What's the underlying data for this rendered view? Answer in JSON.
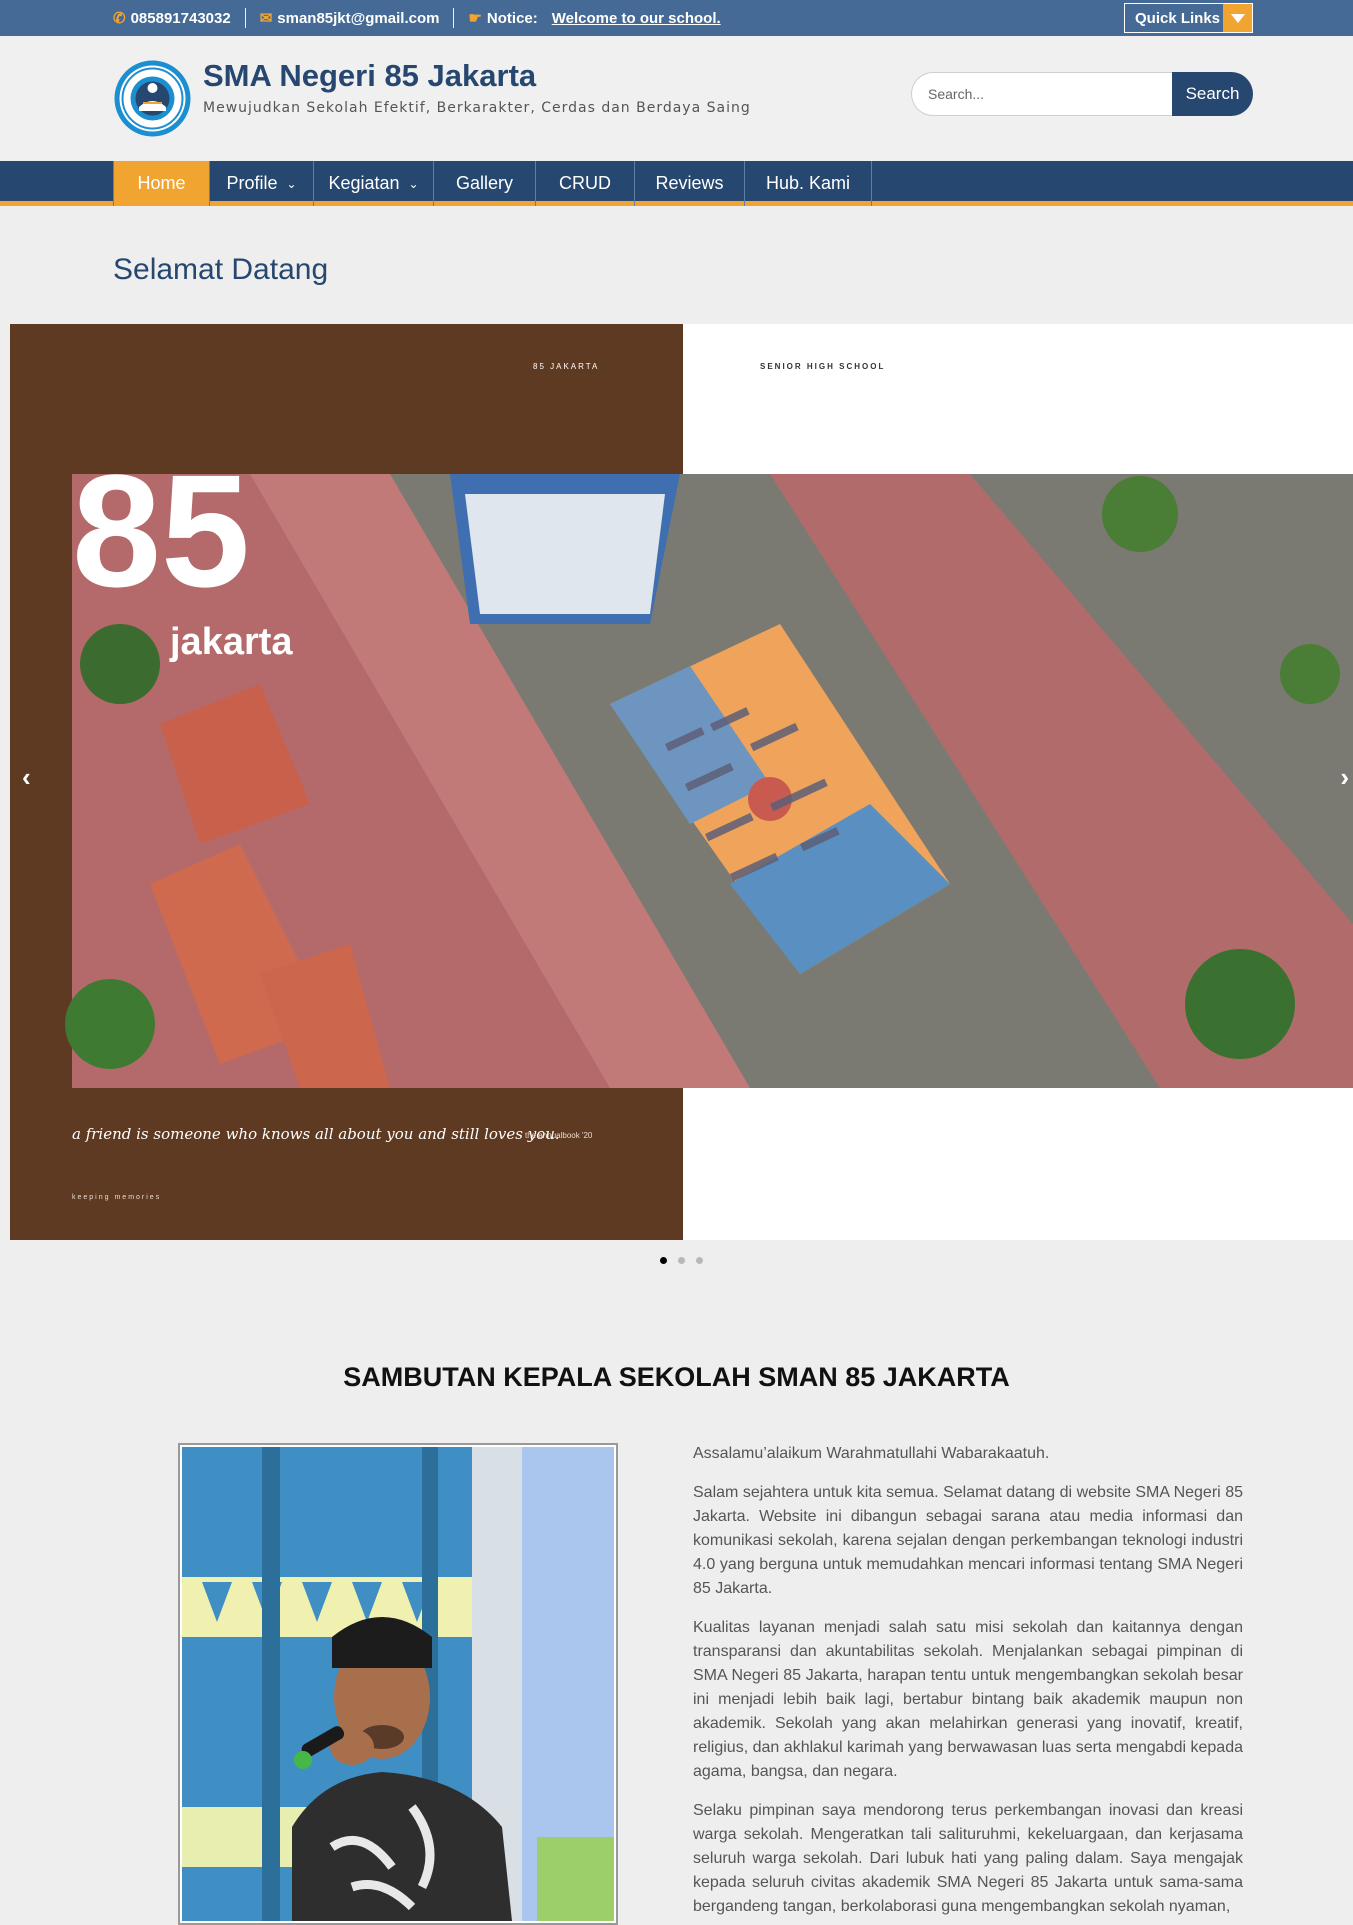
{
  "topbar": {
    "phone": "085891743032",
    "email": "sman85jkt@gmail.com",
    "notice_label": "Notice:",
    "notice_text": "Welcome to our school.",
    "quick_links": "Quick Links"
  },
  "header": {
    "site_title": "SMA Negeri 85 Jakarta",
    "site_description": "Mewujudkan Sekolah Efektif, Berkarakter, Cerdas dan Berdaya Saing",
    "search_placeholder": "Search...",
    "search_button": "Search"
  },
  "nav": {
    "items": [
      {
        "label": "Home"
      },
      {
        "label": "Profile"
      },
      {
        "label": "Kegiatan"
      },
      {
        "label": "Gallery"
      },
      {
        "label": "CRUD"
      },
      {
        "label": "Reviews"
      },
      {
        "label": "Hub. Kami"
      }
    ]
  },
  "welcome": {
    "title": "Selamat Datang"
  },
  "slider": {
    "prev": "‹",
    "next": "›",
    "slide_texts": {
      "school_tag": "85 JAKARTA",
      "level_tag": "SENIOR HIGH SCHOOL",
      "big_number": "85",
      "city": "jakarta",
      "quote": "a friend is someone who knows all about you and still loves you.",
      "annual": "the annualbook '20",
      "footer": "keeping memories"
    },
    "active_slide": 1,
    "slide_count": 3
  },
  "sambutan": {
    "title": "SAMBUTAN KEPALA SEKOLAH SMAN 85 JAKARTA",
    "paragraphs": [
      "Assalamu’alaikum Warahmatullahi Wabarakaatuh.",
      "Salam sejahtera untuk kita semua. Selamat datang di website SMA Negeri 85 Jakarta. Website ini dibangun sebagai sarana atau media informasi dan komunikasi sekolah, karena sejalan dengan perkembangan teknologi industri 4.0 yang berguna untuk memudahkan mencari informasi tentang SMA Negeri 85 Jakarta.",
      "Kualitas layanan menjadi salah satu misi sekolah dan kaitannya dengan transparansi dan akuntabilitas sekolah. Menjalankan sebagai pimpinan di SMA Negeri 85 Jakarta, harapan tentu untuk mengembangkan sekolah besar ini menjadi lebih baik lagi, bertabur bintang baik akademik maupun non akademik. Sekolah yang akan melahirkan generasi yang inovatif, kreatif, religius, dan akhlakul karimah yang berwawasan luas serta mengabdi kepada agama, bangsa, dan negara.",
      "Selaku pimpinan saya mendorong terus perkembangan inovasi dan kreasi warga sekolah. Mengeratkan tali salituruhmi, kekeluargaan, dan kerjasama seluruh warga sekolah. Dari lubuk hati yang paling dalam. Saya mengajak kepada seluruh civitas akademik SMA Negeri 85 Jakarta untuk sama-sama bergandeng tangan, berkolaborasi guna mengembangkan sekolah nyaman,"
    ]
  },
  "colors": {
    "topbar": "#456a95",
    "navy": "#26476f",
    "accent": "#f2a431",
    "page_bg": "#eeeeee",
    "slide_brown": "#5e3a22"
  },
  "icons": {
    "phone": "phone-icon",
    "email": "envelope-icon",
    "notice": "hand-pointing-icon",
    "quick_links": "caret-down-icon"
  }
}
